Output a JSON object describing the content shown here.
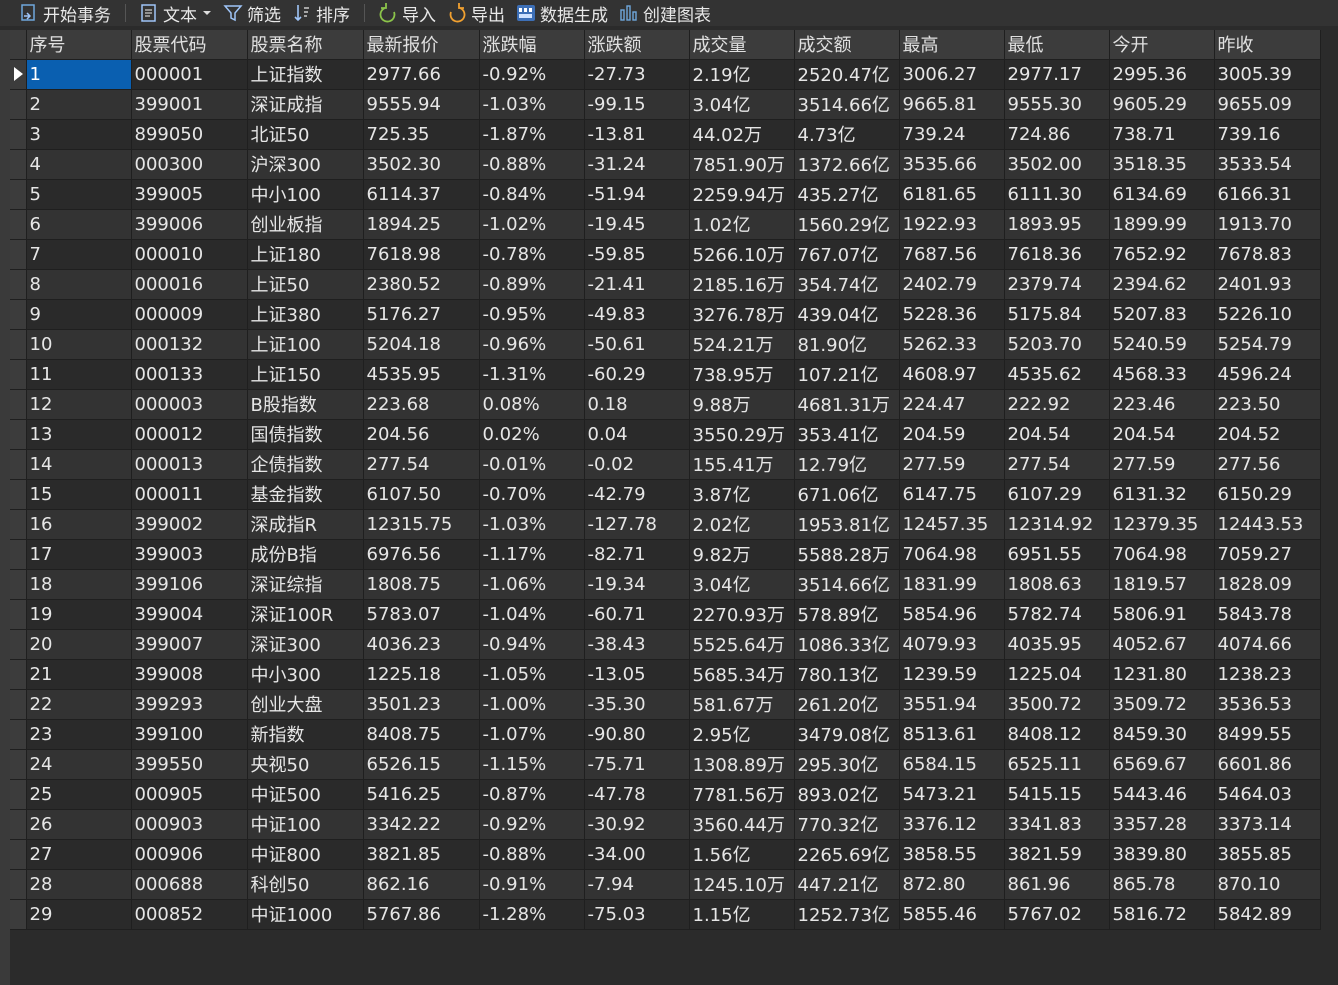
{
  "toolbar": {
    "begin_tx": "开始事务",
    "text": "文本",
    "filter": "筛选",
    "sort": "排序",
    "import": "导入",
    "export": "导出",
    "datagen": "数据生成",
    "chart": "创建图表"
  },
  "columns": [
    "序号",
    "股票代码",
    "股票名称",
    "最新报价",
    "涨跌幅",
    "涨跌额",
    "成交量",
    "成交额",
    "最高",
    "最低",
    "今开",
    "昨收"
  ],
  "rows": [
    [
      "1",
      "000001",
      "上证指数",
      "2977.66",
      "-0.92%",
      "-27.73",
      "2.19亿",
      "2520.47亿",
      "3006.27",
      "2977.17",
      "2995.36",
      "3005.39"
    ],
    [
      "2",
      "399001",
      "深证成指",
      "9555.94",
      "-1.03%",
      "-99.15",
      "3.04亿",
      "3514.66亿",
      "9665.81",
      "9555.30",
      "9605.29",
      "9655.09"
    ],
    [
      "3",
      "899050",
      "北证50",
      "725.35",
      "-1.87%",
      "-13.81",
      "44.02万",
      "4.73亿",
      "739.24",
      "724.86",
      "738.71",
      "739.16"
    ],
    [
      "4",
      "000300",
      "沪深300",
      "3502.30",
      "-0.88%",
      "-31.24",
      "7851.90万",
      "1372.66亿",
      "3535.66",
      "3502.00",
      "3518.35",
      "3533.54"
    ],
    [
      "5",
      "399005",
      "中小100",
      "6114.37",
      "-0.84%",
      "-51.94",
      "2259.94万",
      "435.27亿",
      "6181.65",
      "6111.30",
      "6134.69",
      "6166.31"
    ],
    [
      "6",
      "399006",
      "创业板指",
      "1894.25",
      "-1.02%",
      "-19.45",
      "1.02亿",
      "1560.29亿",
      "1922.93",
      "1893.95",
      "1899.99",
      "1913.70"
    ],
    [
      "7",
      "000010",
      "上证180",
      "7618.98",
      "-0.78%",
      "-59.85",
      "5266.10万",
      "767.07亿",
      "7687.56",
      "7618.36",
      "7652.92",
      "7678.83"
    ],
    [
      "8",
      "000016",
      "上证50",
      "2380.52",
      "-0.89%",
      "-21.41",
      "2185.16万",
      "354.74亿",
      "2402.79",
      "2379.74",
      "2394.62",
      "2401.93"
    ],
    [
      "9",
      "000009",
      "上证380",
      "5176.27",
      "-0.95%",
      "-49.83",
      "3276.78万",
      "439.04亿",
      "5228.36",
      "5175.84",
      "5207.83",
      "5226.10"
    ],
    [
      "10",
      "000132",
      "上证100",
      "5204.18",
      "-0.96%",
      "-50.61",
      "524.21万",
      "81.90亿",
      "5262.33",
      "5203.70",
      "5240.59",
      "5254.79"
    ],
    [
      "11",
      "000133",
      "上证150",
      "4535.95",
      "-1.31%",
      "-60.29",
      "738.95万",
      "107.21亿",
      "4608.97",
      "4535.62",
      "4568.33",
      "4596.24"
    ],
    [
      "12",
      "000003",
      "B股指数",
      "223.68",
      "0.08%",
      "0.18",
      "9.88万",
      "4681.31万",
      "224.47",
      "222.92",
      "223.46",
      "223.50"
    ],
    [
      "13",
      "000012",
      "国债指数",
      "204.56",
      "0.02%",
      "0.04",
      "3550.29万",
      "353.41亿",
      "204.59",
      "204.54",
      "204.54",
      "204.52"
    ],
    [
      "14",
      "000013",
      "企债指数",
      "277.54",
      "-0.01%",
      "-0.02",
      "155.41万",
      "12.79亿",
      "277.59",
      "277.54",
      "277.59",
      "277.56"
    ],
    [
      "15",
      "000011",
      "基金指数",
      "6107.50",
      "-0.70%",
      "-42.79",
      "3.87亿",
      "671.06亿",
      "6147.75",
      "6107.29",
      "6131.32",
      "6150.29"
    ],
    [
      "16",
      "399002",
      "深成指R",
      "12315.75",
      "-1.03%",
      "-127.78",
      "2.02亿",
      "1953.81亿",
      "12457.35",
      "12314.92",
      "12379.35",
      "12443.53"
    ],
    [
      "17",
      "399003",
      "成份B指",
      "6976.56",
      "-1.17%",
      "-82.71",
      "9.82万",
      "5588.28万",
      "7064.98",
      "6951.55",
      "7064.98",
      "7059.27"
    ],
    [
      "18",
      "399106",
      "深证综指",
      "1808.75",
      "-1.06%",
      "-19.34",
      "3.04亿",
      "3514.66亿",
      "1831.99",
      "1808.63",
      "1819.57",
      "1828.09"
    ],
    [
      "19",
      "399004",
      "深证100R",
      "5783.07",
      "-1.04%",
      "-60.71",
      "2270.93万",
      "578.89亿",
      "5854.96",
      "5782.74",
      "5806.91",
      "5843.78"
    ],
    [
      "20",
      "399007",
      "深证300",
      "4036.23",
      "-0.94%",
      "-38.43",
      "5525.64万",
      "1086.33亿",
      "4079.93",
      "4035.95",
      "4052.67",
      "4074.66"
    ],
    [
      "21",
      "399008",
      "中小300",
      "1225.18",
      "-1.05%",
      "-13.05",
      "5685.34万",
      "780.13亿",
      "1239.59",
      "1225.04",
      "1231.80",
      "1238.23"
    ],
    [
      "22",
      "399293",
      "创业大盘",
      "3501.23",
      "-1.00%",
      "-35.30",
      "581.67万",
      "261.20亿",
      "3551.94",
      "3500.72",
      "3509.72",
      "3536.53"
    ],
    [
      "23",
      "399100",
      "新指数",
      "8408.75",
      "-1.07%",
      "-90.80",
      "2.95亿",
      "3479.08亿",
      "8513.61",
      "8408.12",
      "8459.30",
      "8499.55"
    ],
    [
      "24",
      "399550",
      "央视50",
      "6526.15",
      "-1.15%",
      "-75.71",
      "1308.89万",
      "295.30亿",
      "6584.15",
      "6525.11",
      "6569.67",
      "6601.86"
    ],
    [
      "25",
      "000905",
      "中证500",
      "5416.25",
      "-0.87%",
      "-47.78",
      "7781.56万",
      "893.02亿",
      "5473.21",
      "5415.15",
      "5443.46",
      "5464.03"
    ],
    [
      "26",
      "000903",
      "中证100",
      "3342.22",
      "-0.92%",
      "-30.92",
      "3560.44万",
      "770.32亿",
      "3376.12",
      "3341.83",
      "3357.28",
      "3373.14"
    ],
    [
      "27",
      "000906",
      "中证800",
      "3821.85",
      "-0.88%",
      "-34.00",
      "1.56亿",
      "2265.69亿",
      "3858.55",
      "3821.59",
      "3839.80",
      "3855.85"
    ],
    [
      "28",
      "000688",
      "科创50",
      "862.16",
      "-0.91%",
      "-7.94",
      "1245.10万",
      "447.21亿",
      "872.80",
      "861.96",
      "865.78",
      "870.10"
    ],
    [
      "29",
      "000852",
      "中证1000",
      "5767.86",
      "-1.28%",
      "-75.03",
      "1.15亿",
      "1252.73亿",
      "5855.46",
      "5767.02",
      "5816.72",
      "5842.89"
    ]
  ]
}
